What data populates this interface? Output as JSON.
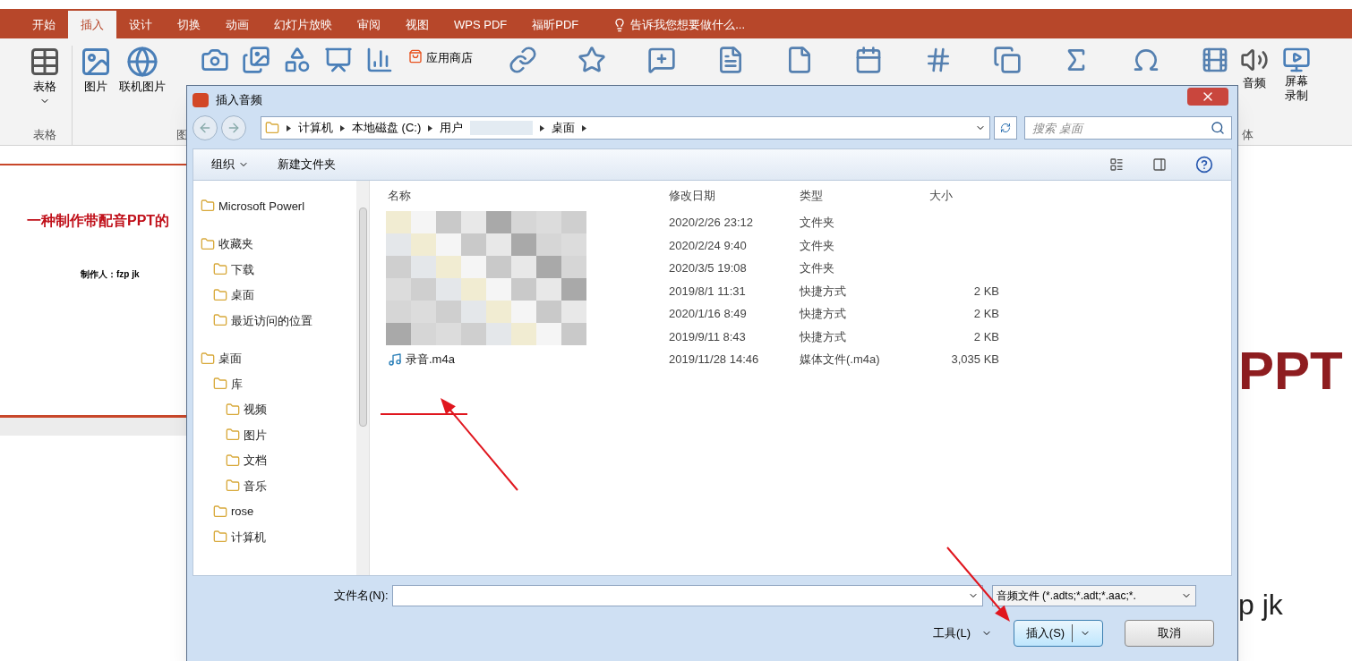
{
  "ribbon": {
    "tabs": [
      {
        "label": "开始",
        "selected": false
      },
      {
        "label": "插入",
        "selected": true
      },
      {
        "label": "设计",
        "selected": false
      },
      {
        "label": "切换",
        "selected": false
      },
      {
        "label": "动画",
        "selected": false
      },
      {
        "label": "幻灯片放映",
        "selected": false
      },
      {
        "label": "审阅",
        "selected": false
      },
      {
        "label": "视图",
        "selected": false
      },
      {
        "label": "WPS PDF",
        "selected": false
      },
      {
        "label": "福昕PDF",
        "selected": false
      }
    ],
    "tell_me": "告诉我您想要做什么...",
    "left_buttons": [
      {
        "label": "表格"
      },
      {
        "label": "图片"
      },
      {
        "label": "联机图片"
      }
    ],
    "left_groups": [
      "表格",
      "图"
    ],
    "store_button": "应用商店",
    "right_buttons": [
      {
        "label": "音频"
      },
      {
        "label": "屏幕录制"
      }
    ],
    "right_group": "体"
  },
  "slide_left": {
    "title": "一种制作带配音PPT的",
    "author": "制作人：fzp jk"
  },
  "slide_right": {
    "title": "PPT",
    "author": "p jk"
  },
  "dialog": {
    "title": "插入音频",
    "breadcrumb": [
      "计算机",
      "本地磁盘 (C:)",
      "用户",
      "桌面"
    ],
    "search": {
      "placeholder": "搜索 桌面"
    },
    "toolbar": {
      "organize": "组织",
      "new_folder": "新建文件夹"
    },
    "nav": [
      {
        "label": "Microsoft Powerl"
      },
      {
        "label": "收藏夹",
        "children": [
          {
            "label": "下载"
          },
          {
            "label": "桌面"
          },
          {
            "label": "最近访问的位置"
          }
        ]
      },
      {
        "label": "桌面",
        "children": [
          {
            "label": "库",
            "children": [
              {
                "label": "视频"
              },
              {
                "label": "图片"
              },
              {
                "label": "文档"
              },
              {
                "label": "音乐"
              }
            ]
          },
          {
            "label": "rose"
          },
          {
            "label": "计算机"
          }
        ]
      }
    ],
    "columns": [
      "名称",
      "修改日期",
      "类型",
      "大小"
    ],
    "rows": [
      {
        "name": "",
        "date": "2020/2/26 23:12",
        "type": "文件夹",
        "size": ""
      },
      {
        "name": "",
        "date": "2020/2/24 9:40",
        "type": "文件夹",
        "size": ""
      },
      {
        "name": "",
        "date": "2020/3/5 19:08",
        "type": "文件夹",
        "size": ""
      },
      {
        "name": "",
        "date": "2019/8/1 11:31",
        "type": "快捷方式",
        "size": "2 KB"
      },
      {
        "name": "",
        "date": "2020/1/16 8:49",
        "type": "快捷方式",
        "size": "2 KB"
      },
      {
        "name": "",
        "date": "2019/9/11 8:43",
        "type": "快捷方式",
        "size": "2 KB"
      },
      {
        "name": "录音.m4a",
        "date": "2019/11/28 14:46",
        "type": "媒体文件(.m4a)",
        "size": "3,035 KB"
      }
    ],
    "filename_label": "文件名(N):",
    "filter": "音频文件 (*.adts;*.adt;*.aac;*.",
    "tools": "工具(L)",
    "insert": "插入(S)",
    "cancel": "取消"
  }
}
